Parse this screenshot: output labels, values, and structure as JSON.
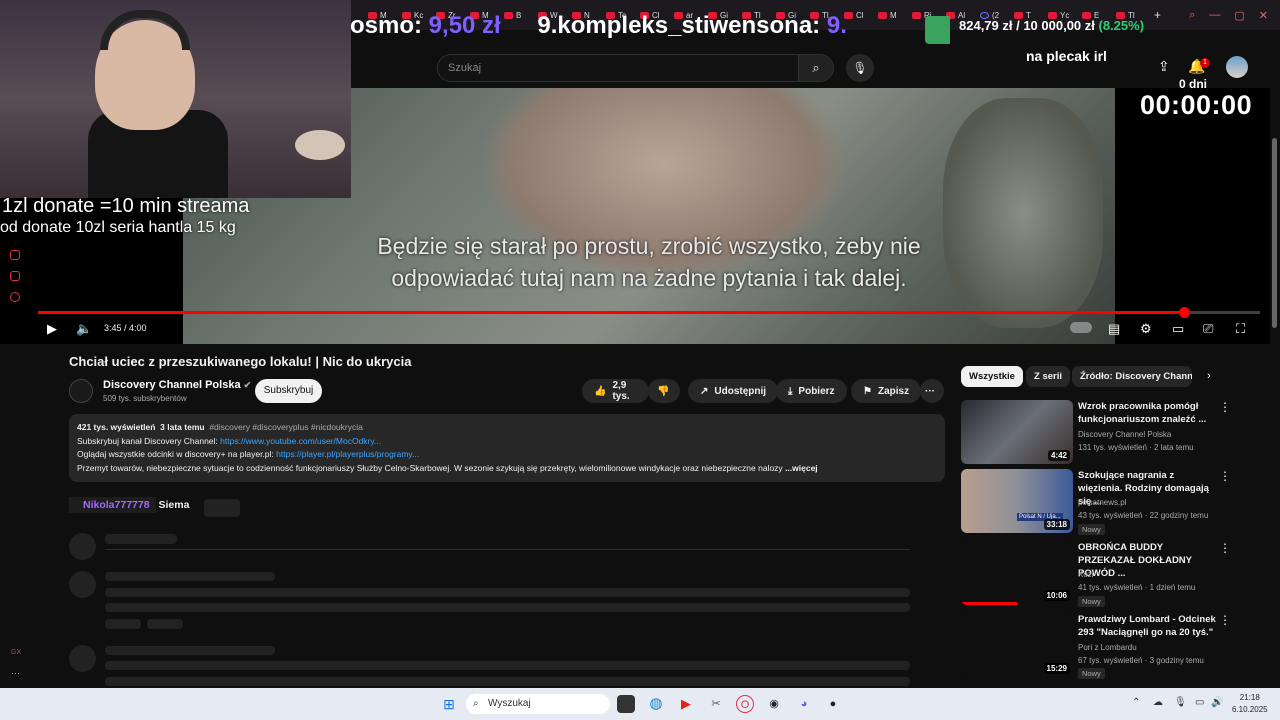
{
  "browser": {
    "tabs": [
      "M",
      "Kc",
      "Zr",
      "M",
      "B",
      "W",
      "N",
      "Tc",
      "Cl",
      "ar",
      "Gi",
      "Tl",
      "Gi",
      "Tl",
      "Cl",
      "M",
      "Ri",
      "Al",
      "(2",
      "T",
      "Yc",
      "E",
      "Tl"
    ],
    "new_tab": "+"
  },
  "overlay": {
    "ticker_prefix": "osmo: ",
    "ticker_price": "9,50 zł",
    "ticker_main": "9.kompleks_stiwensona: ",
    "ticker_tail": "9.",
    "goal_amount": "824,79 zł / 10 000,00 zł ",
    "goal_percent": "(8.25%)",
    "goal_fraction": 0.0825,
    "plecak": "na plecak irl",
    "dni": "0 dni",
    "timer": "00:00:00",
    "donate_line1": "1zl donate =10 min streama",
    "donate_line2": "od donate 10zl seria hantla 15 kg"
  },
  "masthead": {
    "search_placeholder": "Szukaj",
    "notification_count": "1"
  },
  "player": {
    "subtitle_line1": "Będzie się starał po prostu, zrobić wszystko, żeby nie",
    "subtitle_line2": "odpowiadać tutaj nam na żadne pytania i tak dalej.",
    "time": "3:45 / 4:00",
    "progress": 0.9375
  },
  "video": {
    "title": "Chciał uciec z przeszukiwanego lokalu! | Nic do ukrycia",
    "channel": "Discovery Channel Polska",
    "subscribers": "509 tys. subskrybentów",
    "subscribe_label": "Subskrybuj",
    "likes": "2,9 tys.",
    "share_label": "Udostępnij",
    "download_label": "Pobierz",
    "save_label": "Zapisz",
    "more_label": "···"
  },
  "description": {
    "views": "421 tys. wyświetleń",
    "age": "3 lata temu",
    "tags": "#discovery #discoveryplus #nicdoukrycia",
    "line2_text": "Subskrybuj kanał Discovery Channel: ",
    "line2_link": "https://www.youtube.com/user/MocOdkry...",
    "line3_text": "Oglądaj wszystkie odcinki w discovery+ na player.pl: ",
    "line3_link": "https://player.pl/playerplus/programy...",
    "line4_text": "Przemyt towarów, niebezpieczne sytuacje to codzienność funkcjonariuszy Służby Celno-Skarbowej. W sezonie szykują się przekręty, wielomilionowe windykacje oraz niebezpieczne nalozy",
    "more": "...więcej"
  },
  "chat": {
    "user": "Nikola777778",
    "message": "Siema"
  },
  "filter_chips": [
    "Wszystkie",
    "Z serii",
    "Źródło: Discovery Channel"
  ],
  "recommendations": [
    {
      "title": "Wzrok pracownika pomógł funkcjonariuszom znaleźć ...",
      "channel": "Discovery Channel Polska",
      "meta": "131 tys. wyświetleń · 2 lata temu",
      "duration": "4:42",
      "badge": ""
    },
    {
      "title": "Szokujące nagrania z więzienia. Rodziny domagają się ...",
      "channel": "polsatnews.pl",
      "meta": "43 tys. wyświetleń · 22 godziny temu",
      "duration": "33:18",
      "badge": "Nowy",
      "thumb_caption": "Polsat N / Uja..."
    },
    {
      "title": "OBROŃCA BUDDY PRZEKAZAŁ DOKŁADNY POWÓD ...",
      "channel": "Kozi",
      "meta": "41 tys. wyświetleń · 1 dzień temu",
      "duration": "10:06",
      "badge": "Nowy",
      "watched": 0.5
    },
    {
      "title": "Prawdziwy Lombard - Odcinek 293 \"Naciągnęli go na 20 tyś.\"",
      "channel": "Pori z Lombardu",
      "meta": "67 tys. wyświetleń · 3 godziny temu",
      "duration": "15:29",
      "badge": "Nowy"
    }
  ],
  "taskbar": {
    "search_placeholder": "Wyszukaj",
    "time": "21:18",
    "date": "6.10.2025"
  },
  "colors": {
    "accent_red": "#ff0000",
    "ticker_purple": "#7f5fff",
    "goal_green": "#2ecc71",
    "link_blue": "#3ea6ff"
  }
}
